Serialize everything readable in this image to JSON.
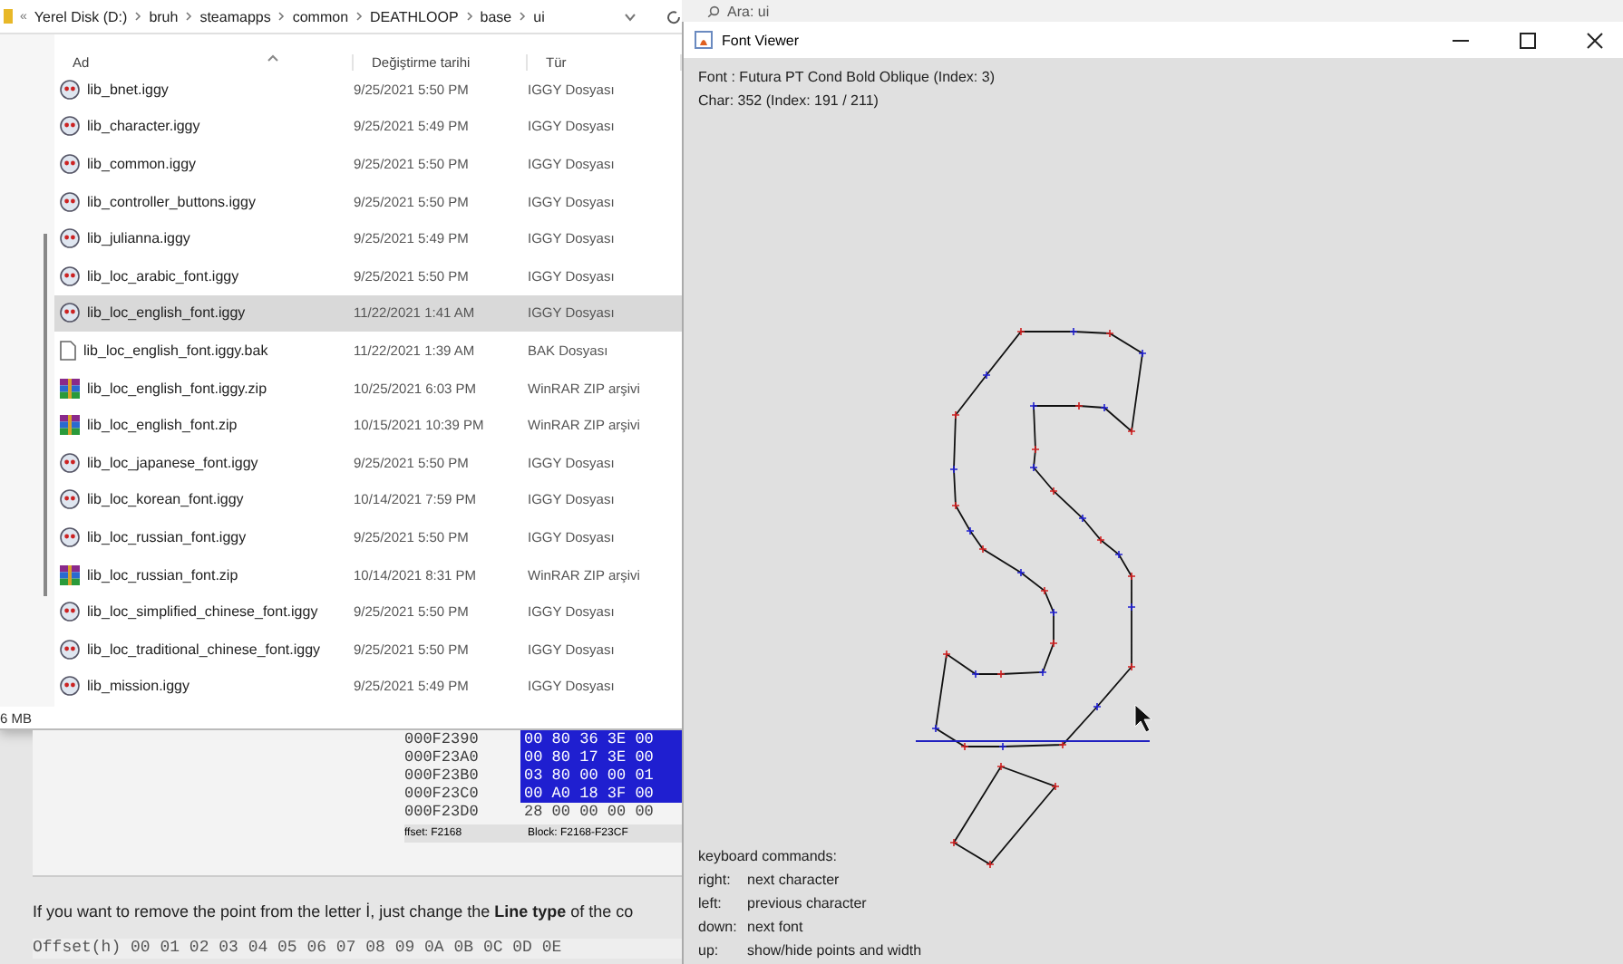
{
  "explorer": {
    "overflow": "«",
    "breadcrumb": [
      "Yerel Disk (D:)",
      "bruh",
      "steamapps",
      "common",
      "DEATHLOOP",
      "base",
      "ui"
    ],
    "columns": [
      "Ad",
      "Değiştirme tarihi",
      "Tür"
    ],
    "files": [
      {
        "name": "lib_bnet.iggy",
        "date": "9/25/2021 5:50 PM",
        "type": "IGGY Dosyası",
        "kind": "iggy",
        "selected": false
      },
      {
        "name": "lib_character.iggy",
        "date": "9/25/2021 5:49 PM",
        "type": "IGGY Dosyası",
        "kind": "iggy",
        "selected": false
      },
      {
        "name": "lib_common.iggy",
        "date": "9/25/2021 5:50 PM",
        "type": "IGGY Dosyası",
        "kind": "iggy",
        "selected": false
      },
      {
        "name": "lib_controller_buttons.iggy",
        "date": "9/25/2021 5:50 PM",
        "type": "IGGY Dosyası",
        "kind": "iggy",
        "selected": false
      },
      {
        "name": "lib_julianna.iggy",
        "date": "9/25/2021 5:49 PM",
        "type": "IGGY Dosyası",
        "kind": "iggy",
        "selected": false
      },
      {
        "name": "lib_loc_arabic_font.iggy",
        "date": "9/25/2021 5:50 PM",
        "type": "IGGY Dosyası",
        "kind": "iggy",
        "selected": false
      },
      {
        "name": "lib_loc_english_font.iggy",
        "date": "11/22/2021 1:41 AM",
        "type": "IGGY Dosyası",
        "kind": "iggy",
        "selected": true
      },
      {
        "name": "lib_loc_english_font.iggy.bak",
        "date": "11/22/2021 1:39 AM",
        "type": "BAK Dosyası",
        "kind": "file",
        "selected": false
      },
      {
        "name": "lib_loc_english_font.iggy.zip",
        "date": "10/25/2021 6:03 PM",
        "type": "WinRAR ZIP arşivi",
        "kind": "zip",
        "selected": false
      },
      {
        "name": "lib_loc_english_font.zip",
        "date": "10/15/2021 10:39 PM",
        "type": "WinRAR ZIP arşivi",
        "kind": "zip",
        "selected": false
      },
      {
        "name": "lib_loc_japanese_font.iggy",
        "date": "9/25/2021 5:50 PM",
        "type": "IGGY Dosyası",
        "kind": "iggy",
        "selected": false
      },
      {
        "name": "lib_loc_korean_font.iggy",
        "date": "10/14/2021 7:59 PM",
        "type": "IGGY Dosyası",
        "kind": "iggy",
        "selected": false
      },
      {
        "name": "lib_loc_russian_font.iggy",
        "date": "9/25/2021 5:50 PM",
        "type": "IGGY Dosyası",
        "kind": "iggy",
        "selected": false
      },
      {
        "name": "lib_loc_russian_font.zip",
        "date": "10/14/2021 8:31 PM",
        "type": "WinRAR ZIP arşivi",
        "kind": "zip",
        "selected": false
      },
      {
        "name": "lib_loc_simplified_chinese_font.iggy",
        "date": "9/25/2021 5:50 PM",
        "type": "IGGY Dosyası",
        "kind": "iggy",
        "selected": false
      },
      {
        "name": "lib_loc_traditional_chinese_font.iggy",
        "date": "9/25/2021 5:50 PM",
        "type": "IGGY Dosyası",
        "kind": "iggy",
        "selected": false
      },
      {
        "name": "lib_mission.iggy",
        "date": "9/25/2021 5:49 PM",
        "type": "IGGY Dosyası",
        "kind": "iggy",
        "selected": false
      }
    ],
    "status": "6 MB"
  },
  "search": {
    "placeholder": "Ara: ui"
  },
  "web_page": {
    "hex_rows": [
      {
        "offset": "000F2390",
        "bytes": "00 80 36 3E 00",
        "selected": true
      },
      {
        "offset": "000F23A0",
        "bytes": "00 80 17 3E 00",
        "selected": true
      },
      {
        "offset": "000F23B0",
        "bytes": "03 80 00 00 01",
        "selected": true
      },
      {
        "offset": "000F23C0",
        "bytes": "00 A0 18 3F 00",
        "selected": true
      },
      {
        "offset": "000F23D0",
        "bytes": "28 00 00 00 00",
        "selected": false
      }
    ],
    "hex_status": [
      "ffset: F2168",
      "Block: F2168-F23CF"
    ],
    "paragraph": "If you want to remove the point from the letter İ, just change the **Line type** of the co",
    "code_line": "Offset(h)  00 01 02 03 04 05 06 07 08 09 0A 0B 0C 0D 0E"
  },
  "font_viewer": {
    "title": "Font Viewer",
    "font_info": "Font : Futura PT Cond Bold Oblique (Index: 3)",
    "char_info": "Char: 352 (Index: 191 / 211)",
    "commands_title": "keyboard commands:",
    "commands": [
      {
        "key": "right:",
        "action": "next character"
      },
      {
        "key": "left:",
        "action": "previous character"
      },
      {
        "key": "down:",
        "action": "next font"
      },
      {
        "key": "up:",
        "action": "show/hide points and width"
      }
    ]
  }
}
